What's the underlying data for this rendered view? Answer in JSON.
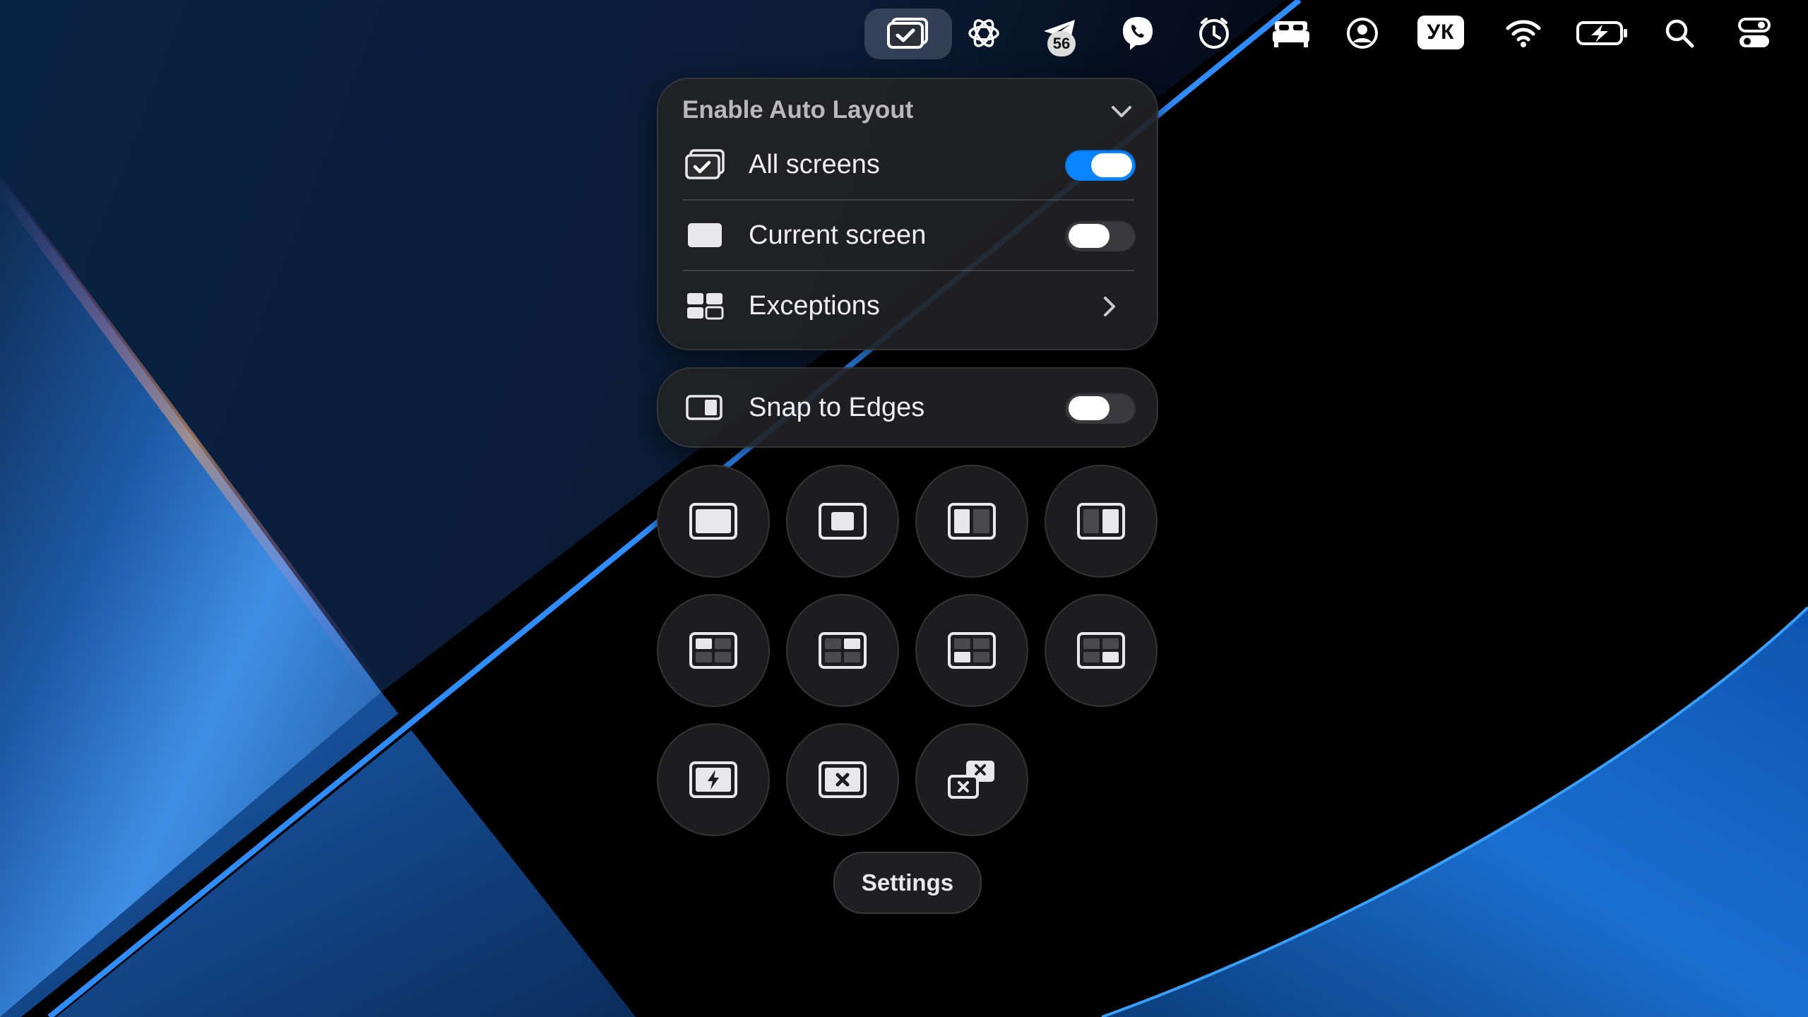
{
  "menubar": {
    "notification_badge": "56",
    "keyboard_layout": "УК",
    "items": [
      {
        "icon": "auto-layout-icon",
        "active": true
      },
      {
        "icon": "chatgpt-icon"
      },
      {
        "icon": "telegram-icon"
      },
      {
        "icon": "viber-icon"
      },
      {
        "icon": "clock-icon"
      },
      {
        "icon": "bed-icon"
      },
      {
        "icon": "user-account-icon"
      },
      {
        "icon": "keyboard-layout-icon"
      },
      {
        "icon": "wifi-icon"
      },
      {
        "icon": "battery-charging-icon"
      },
      {
        "icon": "spotlight-search-icon"
      },
      {
        "icon": "control-center-icon"
      }
    ]
  },
  "auto_layout": {
    "title": "Enable Auto Layout",
    "all_screens": {
      "label": "All screens",
      "enabled": true
    },
    "current_screen": {
      "label": "Current screen",
      "enabled": false
    },
    "exceptions": {
      "label": "Exceptions"
    }
  },
  "snap": {
    "label": "Snap to Edges",
    "enabled": false
  },
  "actions": [
    {
      "icon": "maximize-icon"
    },
    {
      "icon": "center-window-icon"
    },
    {
      "icon": "left-half-icon"
    },
    {
      "icon": "right-half-icon"
    },
    {
      "icon": "top-left-quarter-icon"
    },
    {
      "icon": "top-right-quarter-icon"
    },
    {
      "icon": "bottom-left-quarter-icon"
    },
    {
      "icon": "bottom-right-quarter-icon"
    },
    {
      "icon": "quick-action-icon"
    },
    {
      "icon": "close-window-icon"
    },
    {
      "icon": "close-other-windows-icon"
    }
  ],
  "settings_label": "Settings",
  "colors": {
    "accent": "#0a84ff",
    "panel": "#222224",
    "wallpaper_blue": "#2f7fe0"
  }
}
